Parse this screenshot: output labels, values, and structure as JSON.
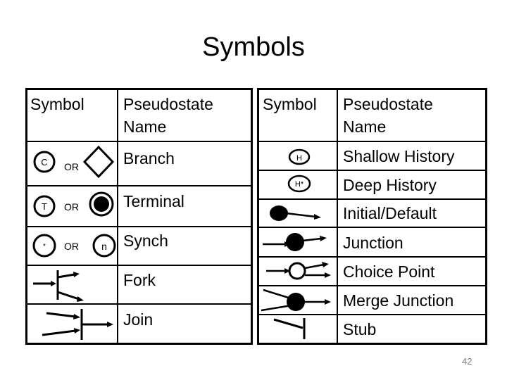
{
  "slide": {
    "title": "Symbols",
    "page_number": "42"
  },
  "left_table": {
    "headers": {
      "symbol": "Symbol",
      "name_line1": "Pseudostate",
      "name_line2": "Name"
    },
    "rows": [
      {
        "name": "Branch",
        "symbol": "circle-C OR diamond",
        "glyph_a": "C",
        "or": "OR"
      },
      {
        "name": "Terminal",
        "symbol": "circle-T OR bullseye",
        "glyph_a": "T",
        "or": "OR"
      },
      {
        "name": "Synch",
        "symbol": "circle-* OR circle-n",
        "glyph_a": "*",
        "or": "OR",
        "glyph_b": "n"
      },
      {
        "name": "Fork",
        "symbol": "fork-bar-arrows"
      },
      {
        "name": "Join",
        "symbol": "join-bar-arrows"
      }
    ]
  },
  "right_table": {
    "headers": {
      "symbol": "Symbol",
      "name_line1": "Pseudostate",
      "name_line2": "Name"
    },
    "rows": [
      {
        "name": "Shallow History",
        "symbol": "ellipse-H",
        "glyph": "H"
      },
      {
        "name": "Deep History",
        "symbol": "ellipse-H*",
        "glyph": "H*"
      },
      {
        "name": "Initial/Default",
        "symbol": "filled-dot-arrow"
      },
      {
        "name": "Junction",
        "symbol": "arrow-filled-dot-arrow"
      },
      {
        "name": "Choice Point",
        "symbol": "arrow-hollow-circle-two-arrows"
      },
      {
        "name": "Merge Junction",
        "symbol": "two-lines-filled-dot-arrow"
      },
      {
        "name": "Stub",
        "symbol": "line-to-bar"
      }
    ]
  }
}
